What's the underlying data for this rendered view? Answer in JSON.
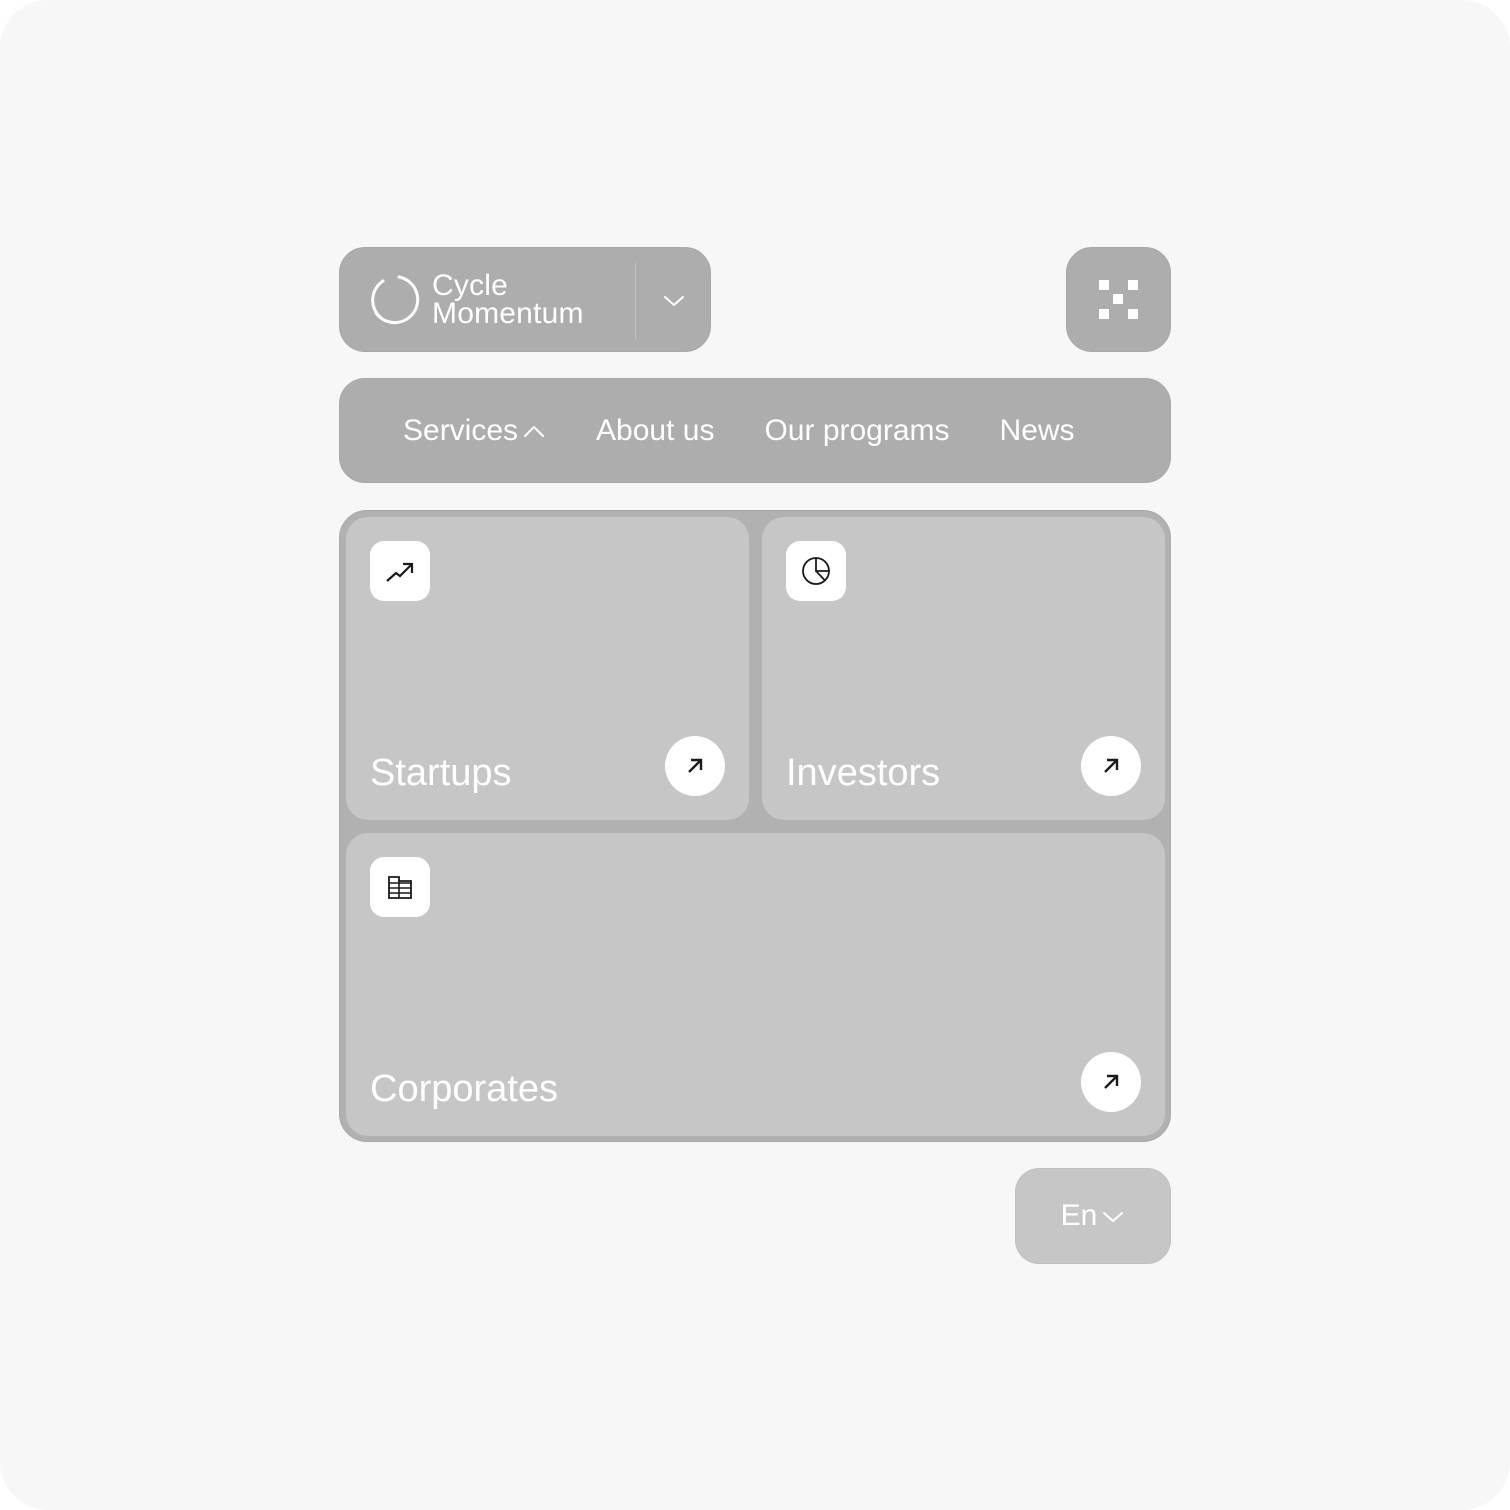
{
  "header": {
    "brand_line1": "Cycle",
    "brand_line2": "Momentum",
    "brand_dropdown_icon": "chevron-down-icon",
    "menu_icon": "close-dots-icon"
  },
  "nav": {
    "items": [
      {
        "label": "Services",
        "icon": "chevron-up-icon",
        "expanded": true
      },
      {
        "label": "About us"
      },
      {
        "label": "Our programs"
      },
      {
        "label": "News"
      }
    ]
  },
  "services": {
    "cards": [
      {
        "label": "Startups",
        "icon": "trending-up-icon",
        "action_icon": "arrow-up-right-icon"
      },
      {
        "label": "Investors",
        "icon": "pie-chart-icon",
        "action_icon": "arrow-up-right-icon"
      },
      {
        "label": "Corporates",
        "icon": "building-grid-icon",
        "action_icon": "arrow-up-right-icon"
      }
    ]
  },
  "language": {
    "selected": "En",
    "icon": "chevron-down-icon"
  },
  "colors": {
    "background": "#f7f7f7",
    "pill": "#adadad",
    "panel": "#b1b1b1",
    "card": "#c6c6c6",
    "foreground": "#ffffff",
    "icon_ink": "#1a1a1a"
  }
}
